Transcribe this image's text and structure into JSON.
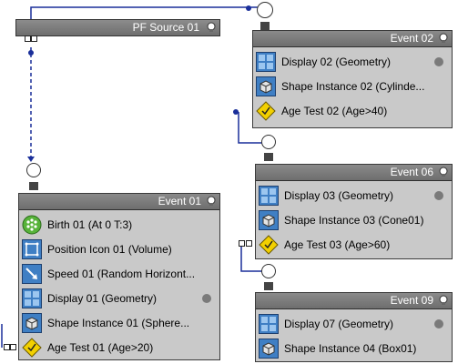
{
  "source": {
    "title": "PF Source 01",
    "bulb_icon": "lightbulb-icon"
  },
  "events": [
    {
      "title": "Event 01",
      "operators": [
        {
          "label": "Birth 01 (At 0 T:3)",
          "icon": "birth-icon"
        },
        {
          "label": "Position Icon 01 (Volume)",
          "icon": "position-icon"
        },
        {
          "label": "Speed 01 (Random Horizont...",
          "icon": "speed-icon"
        },
        {
          "label": "Display 01 (Geometry)",
          "icon": "display-icon",
          "dot": true
        },
        {
          "label": "Shape Instance 01 (Sphere...",
          "icon": "shape-instance-icon"
        },
        {
          "label": "Age Test 01 (Age>20)",
          "icon": "age-test-icon",
          "test": true
        }
      ]
    },
    {
      "title": "Event 02",
      "operators": [
        {
          "label": "Display 02 (Geometry)",
          "icon": "display-icon",
          "dot": true
        },
        {
          "label": "Shape Instance 02 (Cylinde...",
          "icon": "shape-instance-icon"
        },
        {
          "label": "Age Test 02 (Age>40)",
          "icon": "age-test-icon",
          "test": true
        }
      ]
    },
    {
      "title": "Event 06",
      "operators": [
        {
          "label": "Display 03 (Geometry)",
          "icon": "display-icon",
          "dot": true
        },
        {
          "label": "Shape Instance 03 (Cone01)",
          "icon": "shape-instance-icon"
        },
        {
          "label": "Age Test 03 (Age>60)",
          "icon": "age-test-icon",
          "test": true
        }
      ]
    },
    {
      "title": "Event 09",
      "operators": [
        {
          "label": "Display 07 (Geometry)",
          "icon": "display-icon",
          "dot": true
        },
        {
          "label": "Shape Instance 04 (Box01)",
          "icon": "shape-instance-icon"
        }
      ]
    }
  ],
  "colors": {
    "wire": "#1a2f9a",
    "header": "#7a7a7a",
    "node_bg": "#c9c9c9",
    "test_yellow": "#f2d000"
  }
}
